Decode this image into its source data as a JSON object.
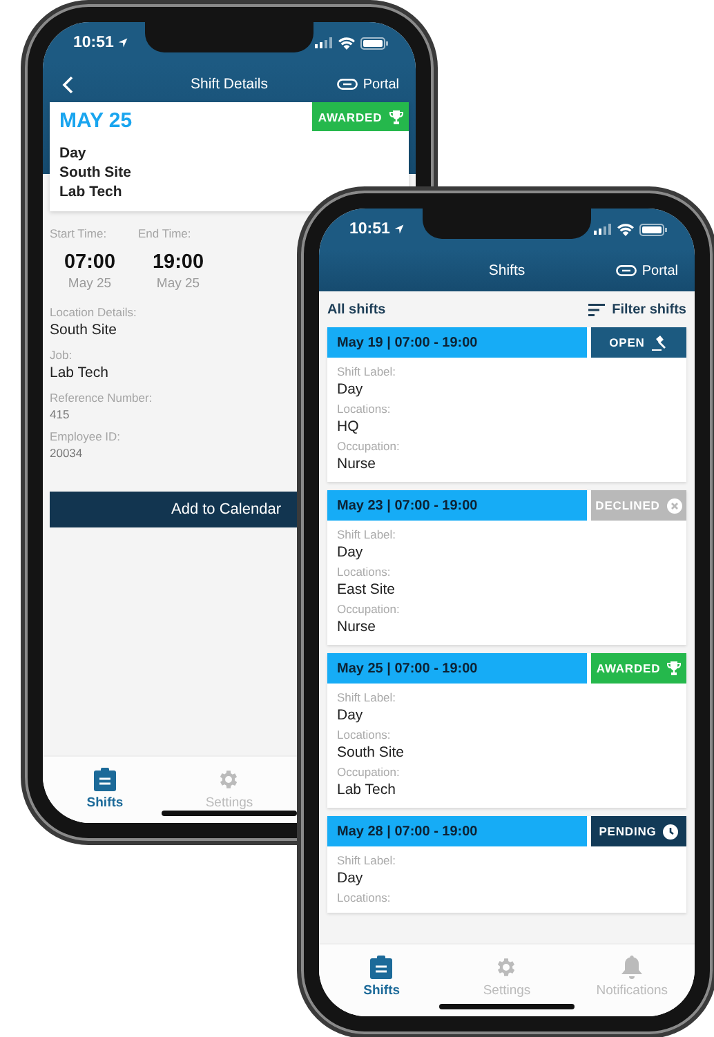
{
  "back_phone": {
    "status_time": "10:51",
    "title": "Shift Details",
    "portal": "Portal",
    "card": {
      "date": "MAY 25",
      "status": {
        "label": "AWARDED",
        "kind": "awarded"
      },
      "lines": [
        "Day",
        "South Site",
        "Lab Tech"
      ]
    },
    "times": [
      {
        "label": "Start Time:",
        "time": "07:00",
        "date": "May 25"
      },
      {
        "label": "End Time:",
        "time": "19:00",
        "date": "May 25"
      }
    ],
    "details": [
      {
        "label": "Location Details:",
        "value": "South Site",
        "kind": "primary"
      },
      {
        "label": "Job:",
        "value": "Lab Tech",
        "kind": "primary"
      },
      {
        "label": "Reference Number:",
        "value": "415",
        "kind": "secondary"
      },
      {
        "label": "Employee ID:",
        "value": "20034",
        "kind": "secondary"
      }
    ],
    "button": "Add to Calendar",
    "tabs": [
      {
        "label": "Shifts",
        "kind": "shifts",
        "selected": true
      },
      {
        "label": "Settings",
        "kind": "settings",
        "selected": false
      }
    ]
  },
  "front_phone": {
    "status_time": "10:51",
    "title": "Shifts",
    "portal": "Portal",
    "list_title": "All shifts",
    "filter": "Filter shifts",
    "shifts": [
      {
        "heading": "May 19 | 07:00 - 19:00",
        "status": {
          "label": "OPEN",
          "kind": "open"
        },
        "fields": [
          {
            "label": "Shift Label:",
            "value": "Day"
          },
          {
            "label": "Locations:",
            "value": "HQ"
          },
          {
            "label": "Occupation:",
            "value": "Nurse"
          }
        ]
      },
      {
        "heading": "May 23 | 07:00 - 19:00",
        "status": {
          "label": "DECLINED",
          "kind": "declined"
        },
        "fields": [
          {
            "label": "Shift Label:",
            "value": "Day"
          },
          {
            "label": "Locations:",
            "value": "East Site"
          },
          {
            "label": "Occupation:",
            "value": "Nurse"
          }
        ]
      },
      {
        "heading": "May 25 | 07:00 - 19:00",
        "status": {
          "label": "AWARDED",
          "kind": "awarded"
        },
        "fields": [
          {
            "label": "Shift Label:",
            "value": "Day"
          },
          {
            "label": "Locations:",
            "value": "South Site"
          },
          {
            "label": "Occupation:",
            "value": "Lab Tech"
          }
        ]
      },
      {
        "heading": "May 28 | 07:00 - 19:00",
        "status": {
          "label": "PENDING",
          "kind": "pending"
        },
        "fields": [
          {
            "label": "Shift Label:",
            "value": "Day"
          },
          {
            "label": "Locations:"
          }
        ]
      }
    ],
    "tabs": [
      {
        "label": "Shifts",
        "kind": "shifts",
        "selected": true
      },
      {
        "label": "Settings",
        "kind": "settings",
        "selected": false
      },
      {
        "label": "Notifications",
        "kind": "notifications",
        "selected": false
      }
    ]
  }
}
